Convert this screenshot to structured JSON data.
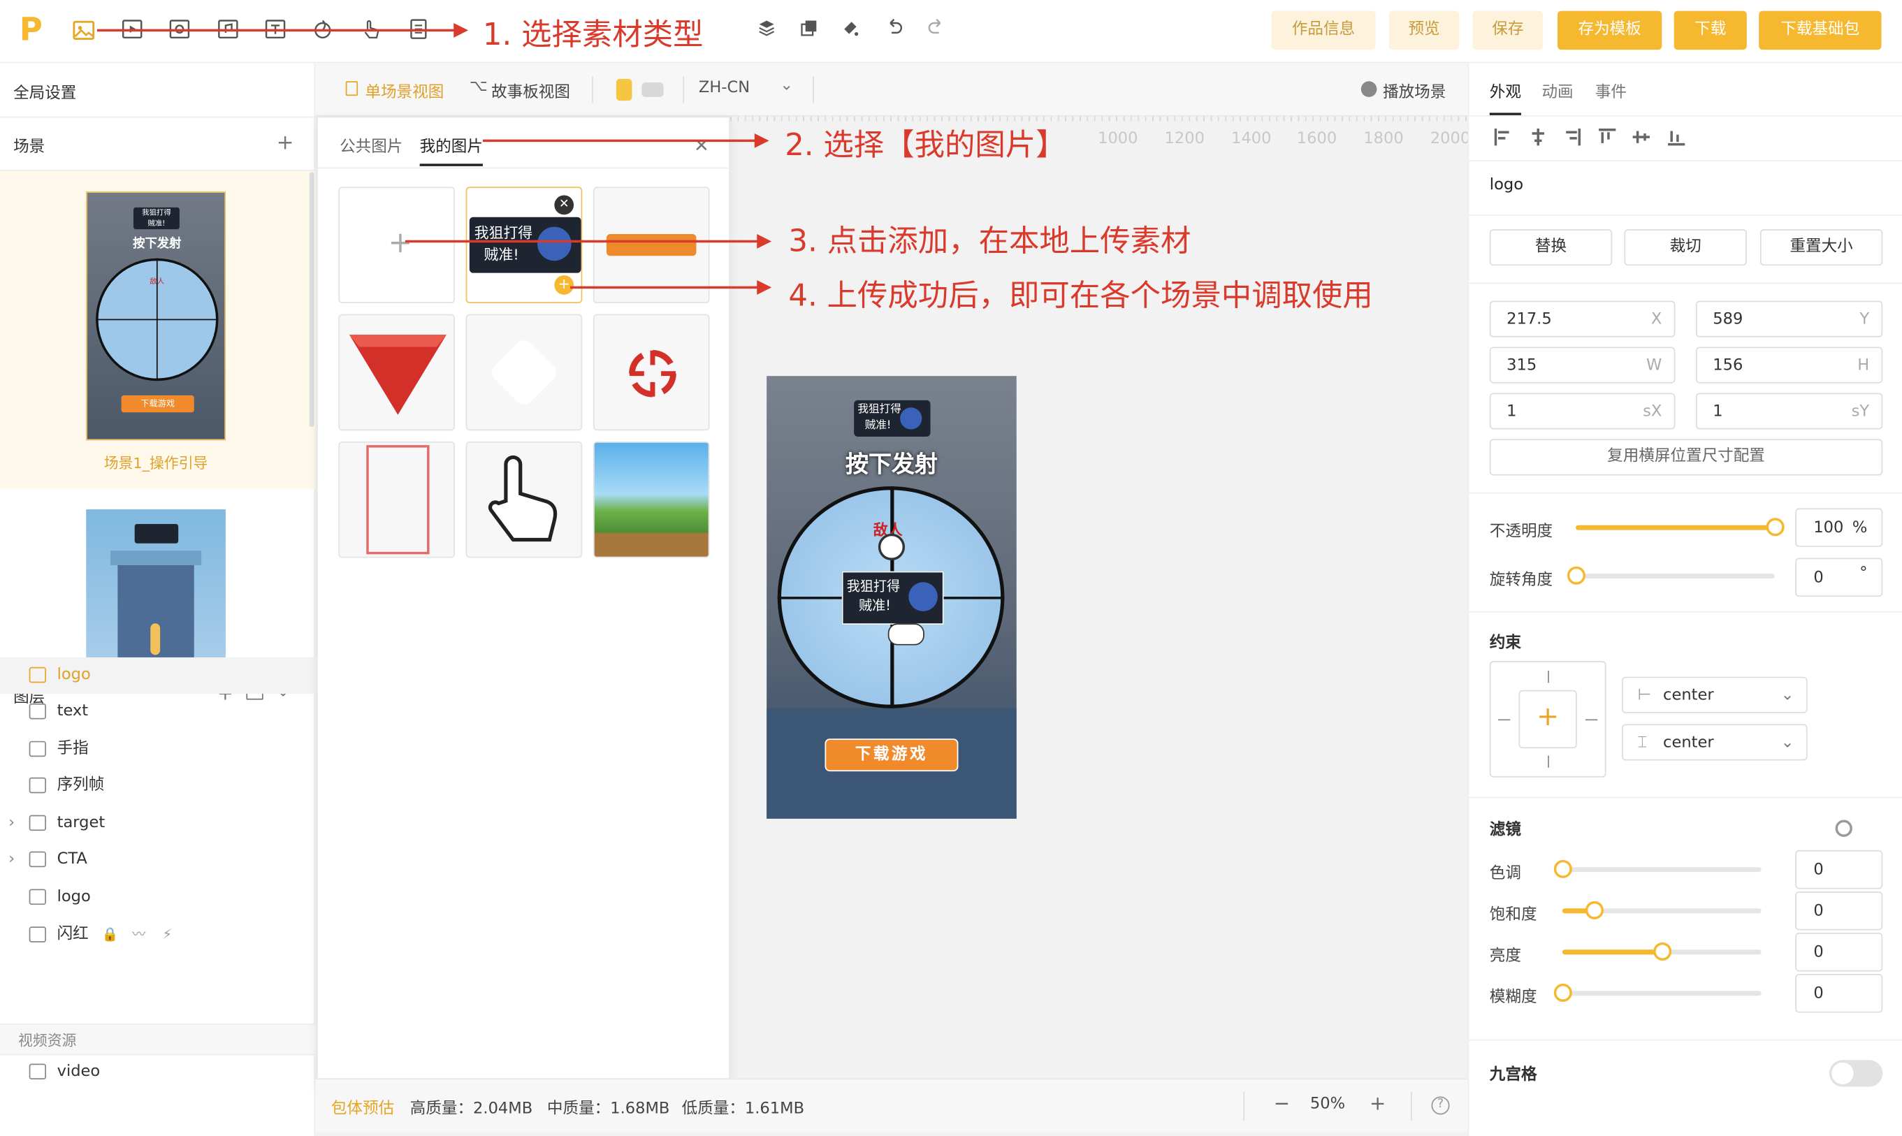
{
  "app": {
    "logo": "P"
  },
  "toolbar": {
    "tools": [
      {
        "name": "image-icon"
      },
      {
        "name": "video-icon"
      },
      {
        "name": "audio-icon"
      },
      {
        "name": "music-icon"
      },
      {
        "name": "text-icon"
      },
      {
        "name": "particle-icon"
      },
      {
        "name": "hand-icon"
      },
      {
        "name": "frame-icon"
      }
    ],
    "history": [
      {
        "name": "layers-icon"
      },
      {
        "name": "copy-icon"
      },
      {
        "name": "paint-icon"
      },
      {
        "name": "undo-icon"
      },
      {
        "name": "redo-icon"
      }
    ],
    "buttons": {
      "info": "作品信息",
      "preview": "预览",
      "save": "保存",
      "save_template": "存为模板",
      "download": "下载",
      "download_base": "下载基础包"
    }
  },
  "annotations": [
    "1. 选择素材类型",
    "2. 选择【我的图片】",
    "3. 点击添加，在本地上传素材",
    "4. 上传成功后，即可在各个场景中调取使用"
  ],
  "left": {
    "global": "全局设置",
    "scenes_title": "场景",
    "scene1_label": "场景1_操作引导",
    "layers_title": "图层",
    "layers": [
      {
        "label": "logo",
        "icon": "image-icon"
      },
      {
        "label": "text",
        "icon": "text-icon"
      },
      {
        "label": "手指",
        "icon": "image-icon"
      },
      {
        "label": "序列帧",
        "icon": "frame-icon"
      },
      {
        "label": "target",
        "icon": "folder-icon"
      },
      {
        "label": "CTA",
        "icon": "folder-icon"
      },
      {
        "label": "logo",
        "icon": "image-icon"
      },
      {
        "label": "闪红",
        "icon": "image-icon"
      }
    ],
    "video_section": "视频资源",
    "video_item": "video"
  },
  "game": {
    "logo_line1": "我狙打得",
    "logo_line2": "贼准!",
    "headline": "按下发射",
    "enemy": "敌人",
    "cta": "下载游戏"
  },
  "canvas_bar": {
    "single": "单场景视图",
    "story": "故事板视图",
    "lang": "ZH-CN",
    "play": "播放场景"
  },
  "ruler": [
    "1000",
    "1200",
    "1400",
    "1600",
    "1800",
    "2000"
  ],
  "library": {
    "tab_public": "公共图片",
    "tab_mine": "我的图片"
  },
  "bottom": {
    "estimate": "包体预估",
    "high": "高质量：2.04MB",
    "mid": "中质量：1.68MB",
    "low": "低质量：1.61MB",
    "zoom": "50%"
  },
  "right": {
    "tabs": [
      "外观",
      "动画",
      "事件"
    ],
    "name": "logo",
    "buttons": [
      "替换",
      "裁切",
      "重置大小"
    ],
    "fields": [
      {
        "value": "217.5",
        "unit": "X"
      },
      {
        "value": "589",
        "unit": "Y"
      },
      {
        "value": "315",
        "unit": "W"
      },
      {
        "value": "156",
        "unit": "H"
      },
      {
        "value": "1",
        "unit": "sX"
      },
      {
        "value": "1",
        "unit": "sY"
      }
    ],
    "reuse": "复用横屏位置尺寸配置",
    "opacity_label": "不透明度",
    "opacity_value": "100",
    "opacity_unit": "%",
    "opacity_level": 1.0,
    "rotate_label": "旋转角度",
    "rotate_value": "0",
    "rotate_unit": "°",
    "rotate_level": 0.0,
    "constraint_title": "约束",
    "constraint_h": "center",
    "constraint_v": "center",
    "filter_title": "滤镜",
    "filters": [
      {
        "label": "色调",
        "value": "0",
        "level": 0.0
      },
      {
        "label": "饱和度",
        "value": "0",
        "level": 0.16
      },
      {
        "label": "亮度",
        "value": "0",
        "level": 0.5
      },
      {
        "label": "模糊度",
        "value": "0",
        "level": 0.0
      }
    ],
    "grid9": "九宫格"
  }
}
